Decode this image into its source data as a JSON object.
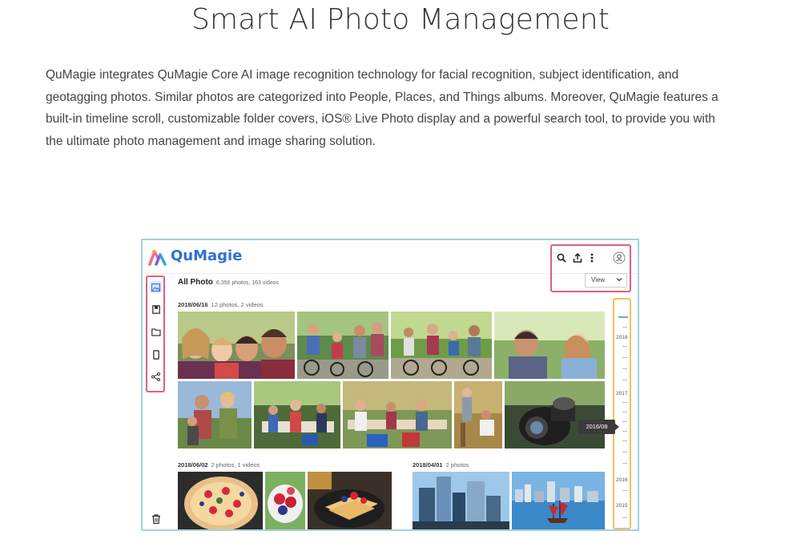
{
  "heading": "Smart AI Photo Management",
  "description": "QuMagie integrates QuMagie Core AI image recognition technology for facial recognition, subject identification, and geotagging photos. Similar photos are categorized into People, Places, and Things albums. Moreover, QuMagie features a built-in timeline scroll, customizable folder covers, iOS® Live Photo display and a powerful search tool, to provide you with the ultimate photo management and image sharing solution.",
  "app": {
    "name": "QuMagie",
    "topbar_icons": [
      "search-icon",
      "upload-icon",
      "more-vert-icon",
      "user-account-icon"
    ],
    "view_select": "View",
    "sidebar_icons": [
      "photos-icon",
      "album-icon",
      "folder-icon",
      "phone-icon",
      "share-icon"
    ],
    "trash_icon": "trash-icon"
  },
  "main": {
    "title": "All Photo",
    "count": "6,356 photos, 163 videos",
    "groups": [
      {
        "date": "2018/06/16",
        "count": "12 photos, 2 videos"
      },
      {
        "date": "2018/06/02",
        "count": "2 photos, 1 videos"
      },
      {
        "date": "2018/04/01",
        "count": "2 photos"
      }
    ]
  },
  "timeline": {
    "years": [
      "2018",
      "2017",
      "2016",
      "2015"
    ],
    "tooltip": "2016/08"
  },
  "colors": {
    "brand_blue": "#2e6fd6",
    "highlight_pink": "#e0607a",
    "highlight_yellow": "#f0c060",
    "frame_teal": "#9ed3e0"
  }
}
